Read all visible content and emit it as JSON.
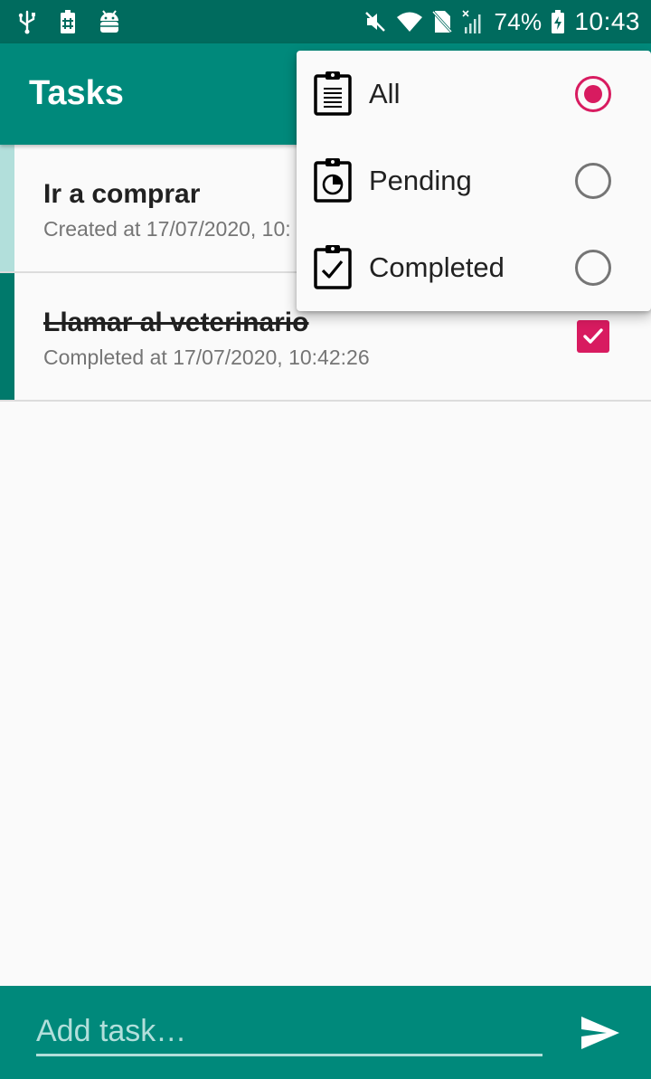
{
  "status_bar": {
    "battery": "74%",
    "time": "10:43",
    "left_icons": [
      "usb-icon",
      "battery-saver-icon",
      "android-debug-icon"
    ],
    "right_icons": [
      "mute-icon",
      "wifi-icon",
      "no-sim-icon",
      "signal-icon",
      "battery-charging-icon"
    ]
  },
  "app_bar": {
    "title": "Tasks"
  },
  "tasks": [
    {
      "title": "Ir a comprar",
      "meta": "Created at 17/07/2020, 10:",
      "completed": false
    },
    {
      "title": "Llamar al veterinario",
      "meta": "Completed at 17/07/2020, 10:42:26",
      "completed": true
    }
  ],
  "filter_menu": {
    "items": [
      {
        "label": "All",
        "icon": "clipboard-list-icon",
        "selected": true
      },
      {
        "label": "Pending",
        "icon": "clipboard-pending-icon",
        "selected": false
      },
      {
        "label": "Completed",
        "icon": "clipboard-check-icon",
        "selected": false
      }
    ]
  },
  "input": {
    "placeholder": "Add task…",
    "value": ""
  },
  "colors": {
    "primary": "#00897b",
    "primary_dark": "#006b5e",
    "accent": "#d81b60",
    "pending_stripe": "#b2dfdb",
    "completed_stripe": "#00796b"
  }
}
